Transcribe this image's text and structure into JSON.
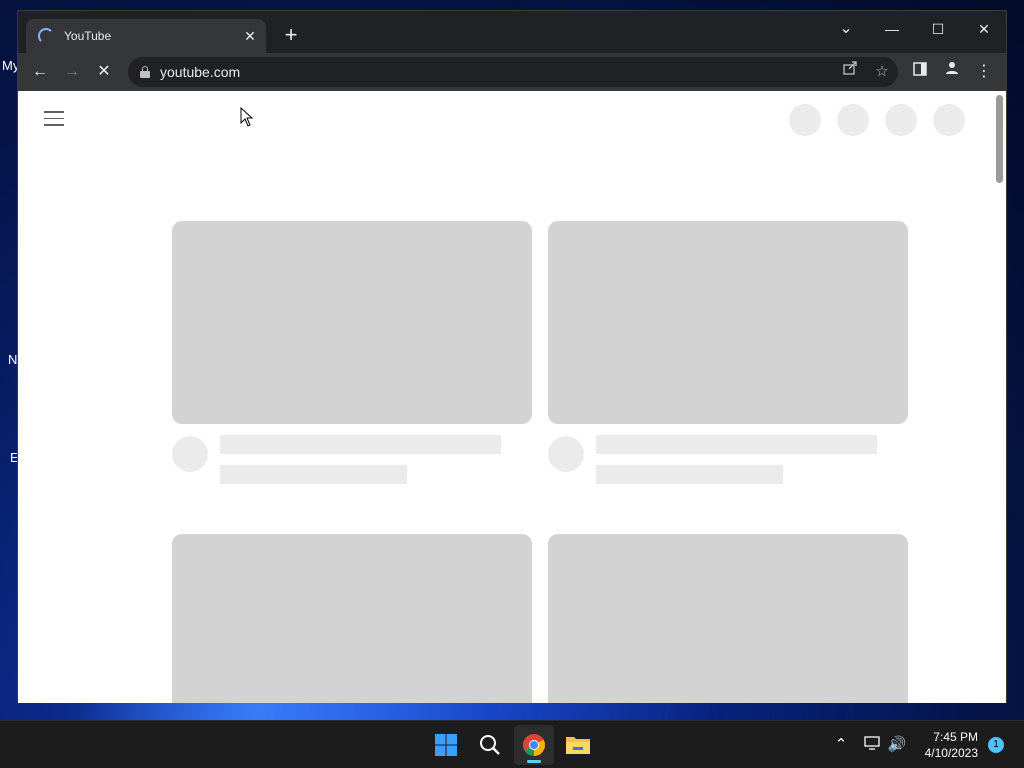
{
  "desktop": {
    "fragments": [
      "My",
      "N",
      "E"
    ]
  },
  "browser": {
    "tab": {
      "title": "YouTube",
      "close": "✕"
    },
    "new_tab": "+",
    "window_controls": {
      "tab_search": "⌄",
      "minimize": "—",
      "maximize": "☐",
      "close": "✕"
    },
    "nav": {
      "back": "←",
      "forward": "→",
      "stop": "✕"
    },
    "address": {
      "url": "youtube.com"
    },
    "toolbar_icons": [
      "share-icon",
      "bookmark-star-icon",
      "side-panel-icon",
      "profile-icon",
      "menu-icon"
    ]
  },
  "page": {
    "state": "loading-skeleton",
    "header_placeholders": 4,
    "video_placeholders": 4
  },
  "taskbar": {
    "apps": [
      "start-button",
      "search-button",
      "chrome-app",
      "file-explorer-app"
    ],
    "clock": {
      "time": "7:45 PM",
      "date": "4/10/2023"
    },
    "notification_count": "1"
  },
  "colors": {
    "chrome_dark": "#202124",
    "chrome_toolbar": "#35363a",
    "skeleton_thumb": "#d3d3d3",
    "skeleton_line": "#ebebeb",
    "taskbar": "#1c1c1c",
    "accent": "#60cdff"
  }
}
